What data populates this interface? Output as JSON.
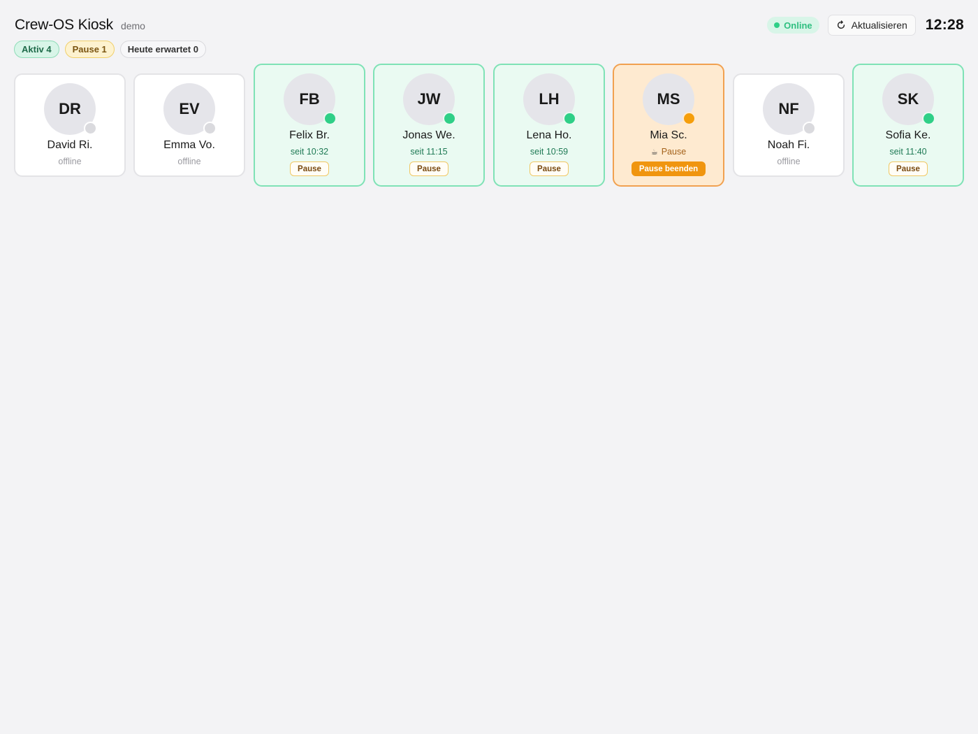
{
  "header": {
    "title": "Crew-OS Kiosk",
    "subtitle": "demo",
    "connection_status": "Online",
    "refresh_label": "Aktualisieren",
    "clock": "12:28"
  },
  "summary": {
    "aktiv": "Aktiv 4",
    "pause": "Pause 1",
    "heute": "Heute erwartet 0"
  },
  "colors": {
    "active": "#2fcf87",
    "pause": "#f59e0b",
    "offline": "#dadade"
  },
  "crew": [
    {
      "initials": "DR",
      "name": "David Ri.",
      "state": "offline",
      "status": "offline"
    },
    {
      "initials": "EV",
      "name": "Emma Vo.",
      "state": "offline",
      "status": "offline"
    },
    {
      "initials": "FB",
      "name": "Felix Br.",
      "state": "active",
      "status": "seit 10:32",
      "action": "Pause"
    },
    {
      "initials": "JW",
      "name": "Jonas We.",
      "state": "active",
      "status": "seit 11:15",
      "action": "Pause"
    },
    {
      "initials": "LH",
      "name": "Lena Ho.",
      "state": "active",
      "status": "seit 10:59",
      "action": "Pause"
    },
    {
      "initials": "MS",
      "name": "Mia Sc.",
      "state": "pause",
      "status": "Pause",
      "status_icon": "coffee-icon",
      "action": "Pause beenden"
    },
    {
      "initials": "NF",
      "name": "Noah Fi.",
      "state": "offline",
      "status": "offline"
    },
    {
      "initials": "SK",
      "name": "Sofia Ke.",
      "state": "active",
      "status": "seit 11:40",
      "action": "Pause"
    }
  ]
}
